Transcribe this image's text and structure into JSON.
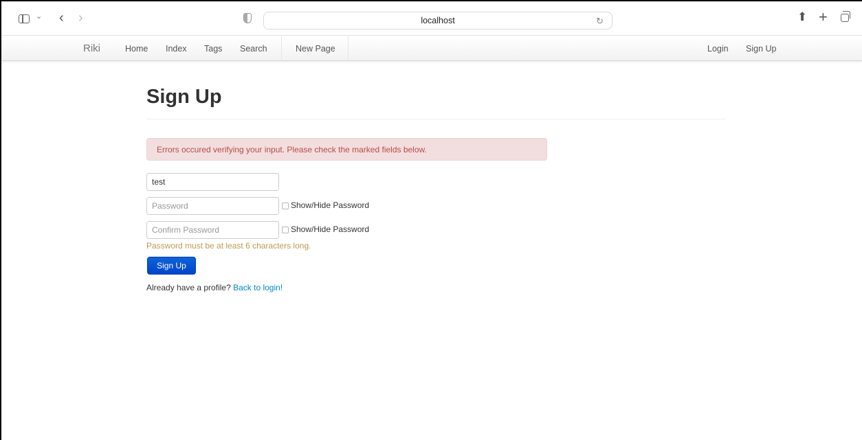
{
  "browser": {
    "address": "localhost"
  },
  "navbar": {
    "brand": "Riki",
    "links": [
      "Home",
      "Index",
      "Tags",
      "Search",
      "New Page"
    ],
    "right_links": [
      "Login",
      "Sign Up"
    ]
  },
  "page": {
    "title": "Sign Up",
    "alert": "Errors occured verifying your input. Please check the marked fields below.",
    "username_value": "test",
    "password_placeholder": "Password",
    "confirm_placeholder": "Confirm Password",
    "show_hide_label": "Show/Hide Password",
    "password_error": "Password must be at least 6 characters long.",
    "submit_label": "Sign Up",
    "login_prompt": "Already have a profile?",
    "login_link": "Back to login!"
  },
  "colors": {
    "primary": "#0044cc",
    "alert_bg": "#f2dede",
    "alert_text": "#b94a48",
    "warning_text": "#c09853",
    "link": "#0088cc"
  }
}
